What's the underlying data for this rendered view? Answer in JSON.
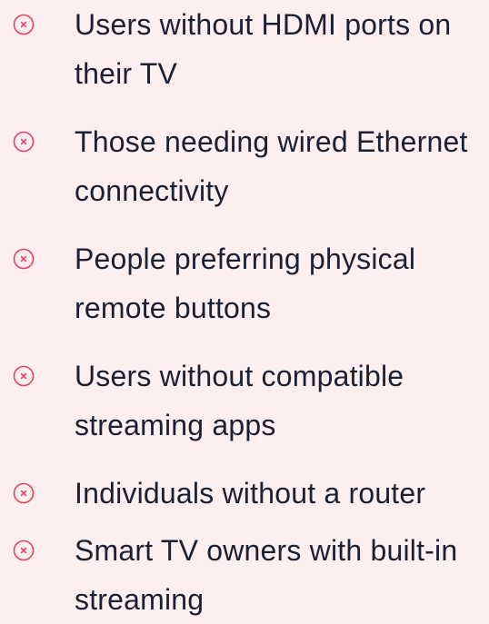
{
  "colors": {
    "background": "#fdeef0",
    "text": "#1a2133",
    "icon": "#e8415f"
  },
  "icon_name": "x-circle-icon",
  "items": [
    {
      "label": "Users without HDMI ports on their TV"
    },
    {
      "label": "Those needing wired Ethernet connectivity"
    },
    {
      "label": "People preferring physical remote buttons"
    },
    {
      "label": "Users without compatible streaming apps"
    },
    {
      "label": "Individuals without a router"
    },
    {
      "label": "Smart TV owners with built-in streaming"
    }
  ]
}
